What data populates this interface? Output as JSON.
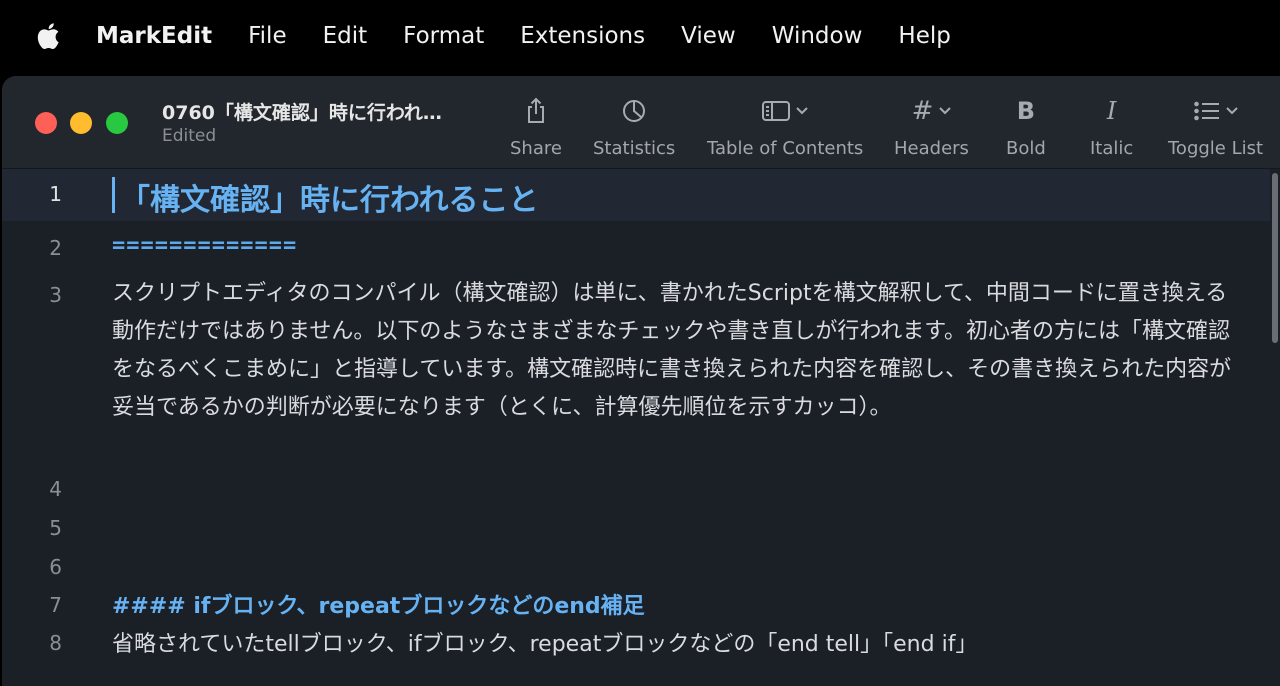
{
  "menubar": {
    "app": "MarkEdit",
    "items": [
      "File",
      "Edit",
      "Format",
      "Extensions",
      "View",
      "Window",
      "Help"
    ]
  },
  "window": {
    "title": "0760「構文確認」時に行われ…",
    "subtitle": "Edited"
  },
  "toolbar": {
    "share": "Share",
    "statistics": "Statistics",
    "toc": "Table of Contents",
    "headers": "Headers",
    "headers_glyph": "#",
    "bold": "Bold",
    "bold_glyph": "B",
    "italic": "Italic",
    "italic_glyph": "I",
    "toggle_list": "Toggle List"
  },
  "editor": {
    "lines": [
      {
        "num": "1",
        "text": "「構文確認」時に行われること"
      },
      {
        "num": "2",
        "text": "============="
      },
      {
        "num": "3",
        "text": "スクリプトエディタのコンパイル（構文確認）は単に、書かれたScriptを構文解釈して、中間コードに置き換える動作だけではありません。以下のようなさまざまなチェックや書き直しが行われます。初心者の方には「構文確認をなるべくこまめに」と指導しています。構文確認時に書き換えられた内容を確認し、その書き換えられた内容が妥当であるかの判断が必要になります（とくに、計算優先順位を示すカッコ）。"
      },
      {
        "num": "4",
        "text": ""
      },
      {
        "num": "5",
        "text": ""
      },
      {
        "num": "6",
        "text": ""
      },
      {
        "num": "7",
        "text": "#### ifブロック、repeatブロックなどのend補足"
      },
      {
        "num": "8",
        "text": "省略されていたtellブロック、ifブロック、repeatブロックなどの「end tell」「end if」"
      }
    ]
  },
  "colors": {
    "heading": "#67b2f2",
    "background": "#1b1f26",
    "toolbar": "#22262d"
  }
}
